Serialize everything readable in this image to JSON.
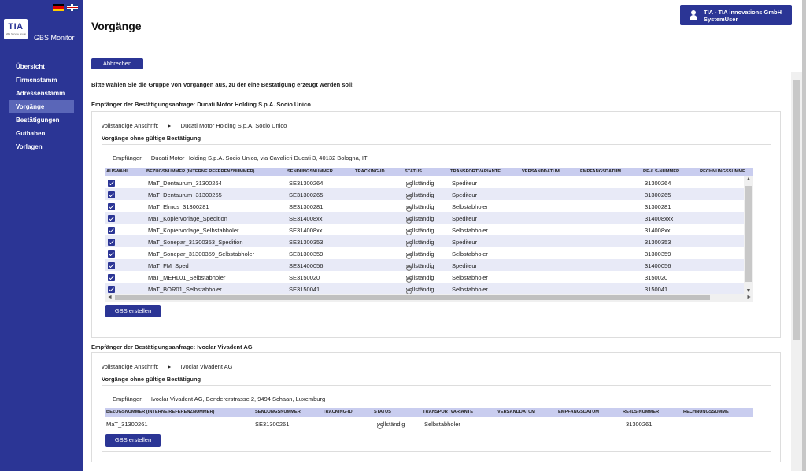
{
  "app": {
    "logo_text": "TIA",
    "logo_subtext": "GBS Service Group",
    "title": "GBS Monitor"
  },
  "languages": [
    "de",
    "en"
  ],
  "nav": {
    "items": [
      {
        "label": "Übersicht",
        "active": false
      },
      {
        "label": "Firmenstamm",
        "active": false
      },
      {
        "label": "Adressenstamm",
        "active": false
      },
      {
        "label": "Vorgänge",
        "active": true
      },
      {
        "label": "Bestätigungen",
        "active": false
      },
      {
        "label": "Guthaben",
        "active": false
      },
      {
        "label": "Vorlagen",
        "active": false
      }
    ]
  },
  "user": {
    "company": "TIA - TIA innovations GmbH",
    "name": "SystemUser",
    "icon": "user-icon"
  },
  "page": {
    "title": "Vorgänge",
    "cancel_label": "Abbrechen",
    "instruction": "Bitte wählen Sie die Gruppe von Vorgängen aus, zu der eine Bestätigung erzeugt werden soll!"
  },
  "groups": [
    {
      "heading": "Empfänger der Bestätigungsanfrage: Ducati Motor Holding S.p.A. Socio Unico",
      "full_address_label": "vollständige Anschrift:",
      "full_address_value": "Ducati Motor Holding S.p.A. Socio Unico",
      "sub_heading": "Vorgänge ohne gültige Bestätigung",
      "recipient_label": "Empfänger:",
      "recipient_value": "Ducati Motor Holding S.p.A. Socio Unico, via Cavalieri Ducati 3, 40132 Bologna, IT",
      "columns": [
        "AUSWAHL",
        "BEZUGSNUMMER (INTERNE REFERENZNUMMER)",
        "SENDUNGSNUMMER",
        "TRACKING-ID",
        "STATUS",
        "TRANSPORTVARIANTE",
        "VERSANDDATUM",
        "EMPFANGSDATUM",
        "RE-/LS-NUMMER",
        "RECHNUNGSSUMME"
      ],
      "rows": [
        {
          "selected": true,
          "ref": "MaT_Dentaurum_31300264",
          "shipment": "SE31300264",
          "tracking": "",
          "status": "vollständig",
          "transport": "Spediteur",
          "ship_date": "",
          "recv_date": "",
          "invoice_no": "31300264",
          "sum": ""
        },
        {
          "selected": true,
          "ref": "MaT_Dentaurum_31300265",
          "shipment": "SE31300265",
          "tracking": "",
          "status": "vollständig",
          "transport": "Spediteur",
          "ship_date": "",
          "recv_date": "",
          "invoice_no": "31300265",
          "sum": ""
        },
        {
          "selected": true,
          "ref": "MaT_Elmos_31300281",
          "shipment": "SE31300281",
          "tracking": "",
          "status": "vollständig",
          "transport": "Selbstabholer",
          "ship_date": "",
          "recv_date": "",
          "invoice_no": "31300281",
          "sum": ""
        },
        {
          "selected": true,
          "ref": "MaT_Kopiervorlage_Spedition",
          "shipment": "SE314008xx",
          "tracking": "",
          "status": "vollständig",
          "transport": "Spediteur",
          "ship_date": "",
          "recv_date": "",
          "invoice_no": "314008xxx",
          "sum": ""
        },
        {
          "selected": true,
          "ref": "MaT_Kopiervorlage_Selbstabholer",
          "shipment": "SE314008xx",
          "tracking": "",
          "status": "vollständig",
          "transport": "Selbstabholer",
          "ship_date": "",
          "recv_date": "",
          "invoice_no": "314008xx",
          "sum": ""
        },
        {
          "selected": true,
          "ref": "MaT_Sonepar_31300353_Spedition",
          "shipment": "SE31300353",
          "tracking": "",
          "status": "vollständig",
          "transport": "Spediteur",
          "ship_date": "",
          "recv_date": "",
          "invoice_no": "31300353",
          "sum": ""
        },
        {
          "selected": true,
          "ref": "MaT_Sonepar_31300359_Selbstabholer",
          "shipment": "SE31300359",
          "tracking": "",
          "status": "vollständig",
          "transport": "Selbstabholer",
          "ship_date": "",
          "recv_date": "",
          "invoice_no": "31300359",
          "sum": ""
        },
        {
          "selected": true,
          "ref": "MaT_FM_Sped",
          "shipment": "SE31400056",
          "tracking": "",
          "status": "vollständig",
          "transport": "Spediteur",
          "ship_date": "",
          "recv_date": "",
          "invoice_no": "31400056",
          "sum": ""
        },
        {
          "selected": true,
          "ref": "MaT_MEHL01_Selbstabholer",
          "shipment": "SE3150020",
          "tracking": "",
          "status": "vollständig",
          "transport": "Selbstabholer",
          "ship_date": "",
          "recv_date": "",
          "invoice_no": "3150020",
          "sum": ""
        },
        {
          "selected": true,
          "ref": "MaT_BOR01_Selbstabholer",
          "shipment": "SE3150041",
          "tracking": "",
          "status": "vollständig",
          "transport": "Selbstabholer",
          "ship_date": "",
          "recv_date": "",
          "invoice_no": "3150041",
          "sum": ""
        }
      ],
      "button_label": "GBS erstellen"
    },
    {
      "heading": "Empfänger der Bestätigungsanfrage: Ivoclar Vivadent AG",
      "full_address_label": "vollständige Anschrift:",
      "full_address_value": "Ivoclar Vivadent AG",
      "sub_heading": "Vorgänge ohne gültige Bestätigung",
      "recipient_label": "Empfänger:",
      "recipient_value": "Ivoclar Vivadent AG, Bendererstrasse 2, 9494 Schaan, Luxemburg",
      "columns": [
        "BEZUGSNUMMER (INTERNE REFERENZNUMMER)",
        "SENDUNGSNUMMER",
        "TRACKING-ID",
        "STATUS",
        "TRANSPORTVARIANTE",
        "VERSANDDATUM",
        "EMPFANGSDATUM",
        "RE-/LS-NUMMER",
        "RECHNUNGSSUMME"
      ],
      "rows": [
        {
          "ref": "MaT_31300261",
          "shipment": "SE31300261",
          "tracking": "",
          "status": "vollständig",
          "transport": "Selbstabholer",
          "ship_date": "",
          "recv_date": "",
          "invoice_no": "31300261",
          "sum": ""
        }
      ],
      "button_label": "GBS erstellen"
    }
  ]
}
